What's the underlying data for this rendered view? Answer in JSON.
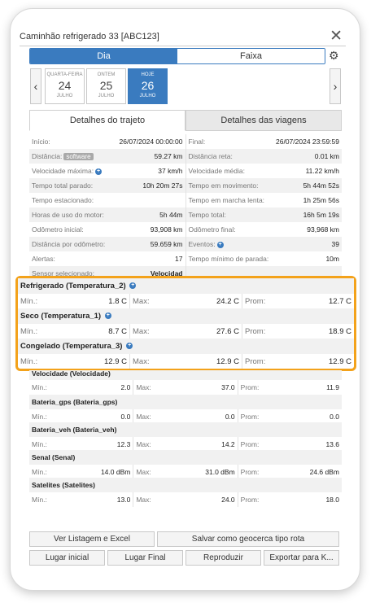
{
  "window": {
    "title": "Caminhão refrigerado 33 [ABC123]"
  },
  "mode": {
    "day": "Dia",
    "range": "Faixa"
  },
  "dates": [
    {
      "dow": "QUARTA-FEIRA",
      "num": "24",
      "mon": "JULHO"
    },
    {
      "dow": "ONTEM",
      "num": "25",
      "mon": "JULHO"
    },
    {
      "dow": "HOJE",
      "num": "26",
      "mon": "JULHO"
    }
  ],
  "tabs": {
    "trip": "Detalhes do trajeto",
    "travels": "Detalhes das viagens"
  },
  "details": [
    {
      "l1": "Início:",
      "v1": "26/07/2024 00:00:00",
      "l2": "Final:",
      "v2": "26/07/2024 23:59:59"
    },
    {
      "l1": "Distância:",
      "badge": "software",
      "v1": "59.27 km",
      "l2": "Distância reta:",
      "v2": "0.01 km"
    },
    {
      "l1": "Velocidade máxima:",
      "v1": "37 km/h",
      "l2": "Velocidade média:",
      "v2": "11.22 km/h"
    },
    {
      "l1": "Tempo total parado:",
      "v1": "10h 20m 27s",
      "l2": "Tempo em movimento:",
      "v2": "5h 44m 52s"
    },
    {
      "l1": "Tempo estacionado:",
      "v1": "",
      "l2": "Tempo em marcha lenta:",
      "v2": "1h 25m 56s"
    },
    {
      "l1": "Horas de uso do motor:",
      "v1": "5h 44m",
      "l2": "Tempo total:",
      "v2": "16h 5m 19s"
    },
    {
      "l1": "Odômetro inicial:",
      "v1": "93,908 km",
      "l2": "Odômetro final:",
      "v2": "93,968 km"
    },
    {
      "l1": "Distância por odômetro:",
      "v1": "59.659 km",
      "l2": "Eventos:",
      "v2": "39"
    },
    {
      "l1": "Alertas:",
      "v1": "17",
      "l2": "Tempo mínimo de parada:",
      "v2": "10m"
    },
    {
      "l1": "Sensor selecionado:",
      "v1": "Velocidad",
      "l2": "",
      "v2": ""
    }
  ],
  "labels": {
    "min": "Mín.:",
    "max": "Max:",
    "avg": "Prom:"
  },
  "highlighted_sensors": [
    {
      "name": "Refrigerado (Temperatura_2)",
      "min": "1.8 C",
      "max": "24.2 C",
      "avg": "12.7 C"
    },
    {
      "name": "Seco (Temperatura_1)",
      "min": "8.7 C",
      "max": "27.6 C",
      "avg": "18.9 C"
    },
    {
      "name": "Congelado (Temperatura_3)",
      "min": "12.9 C",
      "max": "12.9 C",
      "avg": "12.9 C"
    }
  ],
  "sensors": [
    {
      "name": "Velocidade (Velocidade)",
      "min": "2.0",
      "max": "37.0",
      "avg": "11.9"
    },
    {
      "name": "Bateria_gps (Bateria_gps)",
      "min": "0.0",
      "max": "0.0",
      "avg": "0.0"
    },
    {
      "name": "Bateria_veh (Bateria_veh)",
      "min": "12.3",
      "max": "14.2",
      "avg": "13.6"
    },
    {
      "name": "Senal (Senal)",
      "min": "14.0 dBm",
      "max": "31.0 dBm",
      "avg": "24.6 dBm"
    },
    {
      "name": "Satelites (Satelites)",
      "min": "13.0",
      "max": "24.0",
      "avg": "18.0"
    }
  ],
  "buttons": {
    "list_excel": "Ver Listagem e Excel",
    "save_geofence": "Salvar como geocerca tipo rota",
    "start_place": "Lugar inicial",
    "end_place": "Lugar Final",
    "play": "Reproduzir",
    "export": "Exportar para K..."
  },
  "icons": {
    "close": "close-icon",
    "gear": "gear-icon",
    "info": "info-icon",
    "prev": "chevron-left-icon",
    "next": "chevron-right-icon"
  },
  "colors": {
    "accent": "#3a7bbf",
    "highlight": "#f3a21b"
  }
}
